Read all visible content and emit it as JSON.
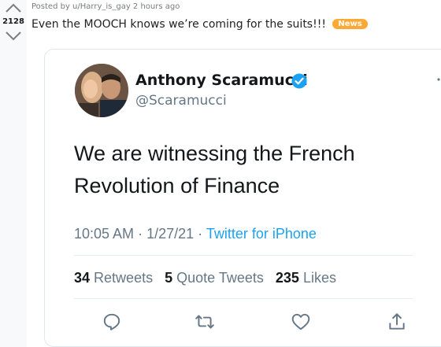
{
  "post": {
    "vote_count": "2128",
    "posted_by": "Posted by u/Harry_is_gay 2 hours ago",
    "title": "Even the MOOCH knows we’re coming for the suits!!!",
    "flair": "News"
  },
  "tweet": {
    "author_name": "Anthony Scaramucci",
    "handle": "@Scaramucci",
    "text_line1": "We are witnessing the French",
    "text_line2": "Revolution of Finance",
    "time": "10:05 AM",
    "date": "1/27/21",
    "source": "Twitter for iPhone",
    "retweets_count": "34",
    "retweets_label": "Retweets",
    "quote_count": "5",
    "quote_label": "Quote Tweets",
    "likes_count": "235",
    "likes_label": "Likes"
  },
  "colors": {
    "flair": "#ffa834",
    "twitter_blue": "#1da1f2",
    "secondary_text": "#657786"
  }
}
